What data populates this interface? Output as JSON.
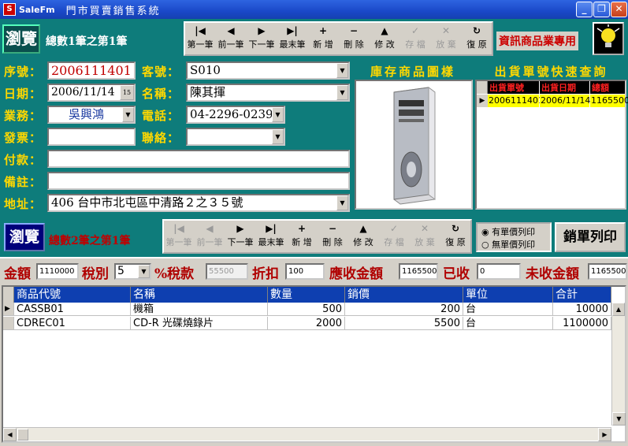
{
  "window": {
    "app_name": "SaleFm",
    "title": "門市買賣銷售系統",
    "min": "_",
    "max": "❐",
    "close": "✕"
  },
  "header": {
    "mode": "瀏覽",
    "record_info": "總數1筆之第1筆",
    "buttons": [
      "第一筆",
      "前一筆",
      "下一筆",
      "最末筆",
      "新 增",
      "刪 除",
      "修 改",
      "存 檔",
      "放 棄",
      "復 原"
    ],
    "brand": "資訊商品業專用"
  },
  "form": {
    "serial_label": "序號：",
    "serial": "2006111401",
    "date_label": "日期：",
    "date": "2006/11/14",
    "staff_label": "業務：",
    "staff": "吳興鴻",
    "invoice_label": "發票：",
    "invoice": "",
    "payment_label": "付款：",
    "payment": "",
    "note_label": "備註：",
    "note": "",
    "address_label": "地址：",
    "address": "406 台中市北屯區中清路２之３５號",
    "customer_no_label": "客號：",
    "customer_no": "S010",
    "name_label": "名稱：",
    "name": "陳其揮",
    "phone_label": "電話：",
    "phone": "04-2296-0239",
    "contact_label": "聯絡：",
    "contact": ""
  },
  "image_panel": {
    "title": "庫存商品圖樣"
  },
  "quick_query": {
    "title": "出貨單號快速查詢",
    "columns": [
      "出貨單號",
      "出貨日期",
      "總額"
    ],
    "rows": [
      [
        "2006111401",
        "2006/11/14",
        "1165500"
      ]
    ]
  },
  "detail_bar": {
    "mode": "瀏覽",
    "record_info": "總數2筆之第1筆",
    "buttons": [
      "第一筆",
      "前一筆",
      "下一筆",
      "最末筆",
      "新 增",
      "刪 除",
      "修 改",
      "存 檔",
      "放 棄",
      "復 原"
    ],
    "print_with_price": "有單價列印",
    "print_without_price": "無單價列印",
    "print_button": "銷單列印"
  },
  "totals": {
    "amount_label": "金額",
    "amount": "1110000",
    "tax_type_label": "稅別",
    "tax_type": "5",
    "tax_label": "%稅款",
    "tax": "55500",
    "discount_label": "折扣",
    "discount": "100",
    "receivable_label": "應收金額",
    "receivable": "1165500",
    "received_label": "已收",
    "received": "0",
    "unreceived_label": "未收金額",
    "unreceived": "1165500"
  },
  "items": {
    "columns": [
      "商品代號",
      "名稱",
      "數量",
      "銷價",
      "單位",
      "合計"
    ],
    "rows": [
      [
        "CASSB01",
        "機箱",
        "500",
        "200",
        "台",
        "10000"
      ],
      [
        "CDREC01",
        "CD-R 光碟燒錄片",
        "2000",
        "5500",
        "台",
        "1100000"
      ]
    ]
  }
}
